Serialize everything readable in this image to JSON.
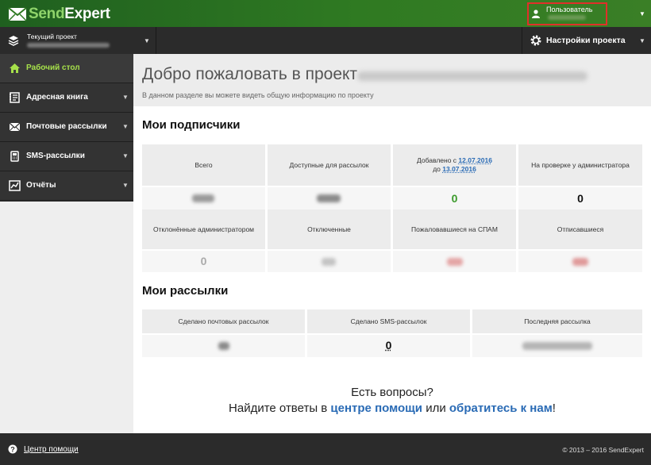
{
  "header": {
    "logo_send": "Send",
    "logo_expert": "Expert",
    "user_label": "Пользователь",
    "project_label": "Текущий проект",
    "settings_label": "Настройки проекта"
  },
  "sidebar": {
    "items": [
      {
        "label": "Рабочий стол",
        "icon": "home-icon"
      },
      {
        "label": "Адресная книга",
        "icon": "address-book-icon"
      },
      {
        "label": "Почтовые рассылки",
        "icon": "envelope-icon"
      },
      {
        "label": "SMS-рассылки",
        "icon": "phone-icon"
      },
      {
        "label": "Отчёты",
        "icon": "chart-icon"
      }
    ]
  },
  "main": {
    "welcome_title": "Добро пожаловать в проект",
    "welcome_sub": "В данном разделе вы можете видеть общую информацию по проекту",
    "subscribers_title": "Мои подписчики",
    "subscribers": {
      "headers": [
        "Всего",
        "Доступные для рассылок",
        "Добавлено с",
        "На проверке у администратора"
      ],
      "added_from": "12.07.2016",
      "added_to_prefix": "до",
      "added_to": "13.07.2016",
      "added_value": "0",
      "moderation_value": "0",
      "headers2": [
        "Отклонённые администратором",
        "Отключенные",
        "Пожаловавшиеся на СПАМ",
        "Отписавшиеся"
      ],
      "rejected_value": "0"
    },
    "mailings_title": "Мои рассылки",
    "mailings": {
      "headers": [
        "Сделано почтовых рассылок",
        "Сделано SMS-рассылок",
        "Последняя рассылка"
      ],
      "sms_value": "0"
    },
    "questions_line1": "Есть вопросы?",
    "questions_prefix": "Найдите ответы в",
    "help_center_link": "центре помощи",
    "or_text": "или",
    "contact_link": "обратитесь к нам",
    "exclam": "!"
  },
  "footer": {
    "help_label": "Центр помощи",
    "copyright": "© 2013 – 2016 SendExpert"
  },
  "colors": {
    "brand_green": "#2f7a22",
    "active_green": "#a6e04a",
    "link_blue": "#2a6bb5",
    "value_green": "#3a9a2a"
  }
}
